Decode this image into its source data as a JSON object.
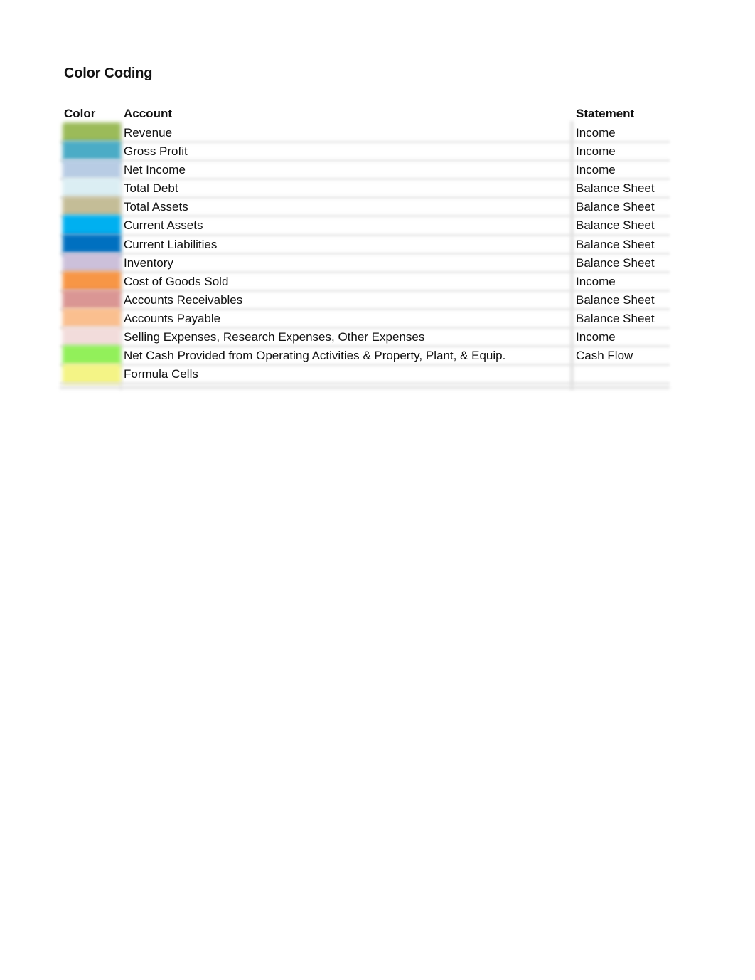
{
  "title": "Color Coding",
  "table": {
    "headers": {
      "color": "Color",
      "account": "Account",
      "statement": "Statement"
    },
    "rows": [
      {
        "color": "#9bbb59",
        "account": "Revenue",
        "statement": "Income"
      },
      {
        "color": "#4bacc6",
        "account": "Gross Profit",
        "statement": "Income"
      },
      {
        "color": "#b8cce4",
        "account": "Net Income",
        "statement": "Income"
      },
      {
        "color": "#dbeef3",
        "account": "Total Debt",
        "statement": "Balance Sheet"
      },
      {
        "color": "#c4bd97",
        "account": "Total Assets",
        "statement": "Balance Sheet"
      },
      {
        "color": "#00b0f0",
        "account": "Current Assets",
        "statement": "Balance Sheet"
      },
      {
        "color": "#0070c0",
        "account": "Current Liabilities",
        "statement": "Balance Sheet"
      },
      {
        "color": "#ccc0da",
        "account": "Inventory",
        "statement": "Balance Sheet"
      },
      {
        "color": "#f79646",
        "account": "Cost of Goods Sold",
        "statement": "Income"
      },
      {
        "color": "#da9694",
        "account": "Accounts Receivables",
        "statement": "Balance Sheet"
      },
      {
        "color": "#fabf8f",
        "account": "Accounts Payable",
        "statement": "Balance Sheet"
      },
      {
        "color": "#f2dcdb",
        "account": "Selling Expenses, Research Expenses, Other Expenses",
        "statement": "Income"
      },
      {
        "color": "#92f05a",
        "account": "Net Cash Provided from Operating Activities & Property, Plant, & Equip.",
        "statement": "Cash Flow"
      },
      {
        "color": "#f4f486",
        "account": "Formula Cells",
        "statement": ""
      }
    ]
  }
}
